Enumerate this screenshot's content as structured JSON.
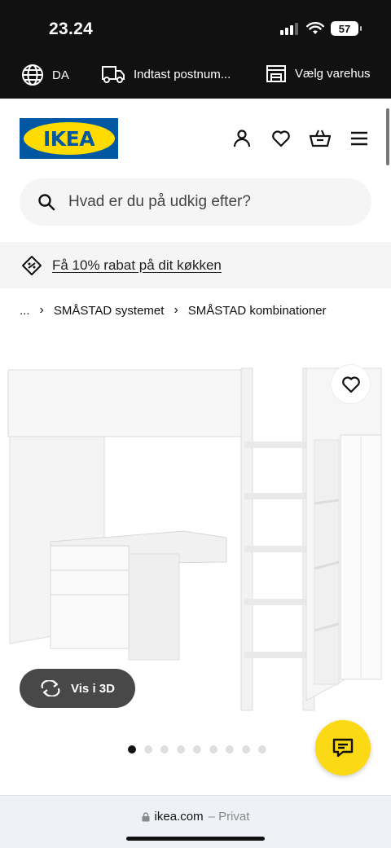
{
  "status": {
    "time": "23.24",
    "battery": "57"
  },
  "utility": {
    "language": "DA",
    "postal": "Indtast postnum...",
    "store": "Vælg varehus"
  },
  "logo": {
    "text": "IKEA"
  },
  "search": {
    "placeholder": "Hvad er du på udkig efter?"
  },
  "promo": {
    "text": "Få 10% rabat på dit køkken"
  },
  "breadcrumb": {
    "ellipsis": "...",
    "items": [
      "SMÅSTAD systemet",
      "SMÅSTAD kombinationer"
    ]
  },
  "product": {
    "view3d_label": "Vis i 3D"
  },
  "carousel": {
    "count": 9,
    "active": 0
  },
  "browser": {
    "domain": "ikea.com",
    "mode": "– Privat"
  },
  "colors": {
    "brand_blue": "#0058a3",
    "brand_yellow": "#ffdb00",
    "chat_yellow": "#fbd914"
  }
}
